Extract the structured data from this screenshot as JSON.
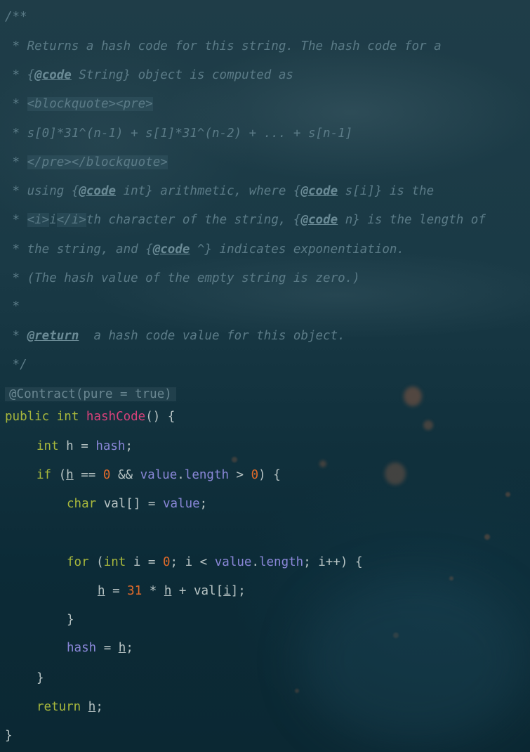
{
  "doc_comment": {
    "open": "/**",
    "line1": " * Returns a hash code for this string. The hash code for a",
    "line2_pre": " * {",
    "line2_tag": "@code",
    "line2_post": " String} object is computed as",
    "line3_star": " * ",
    "line3_html": "<blockquote><pre>",
    "line4": " * s[0]*31^(n-1) + s[1]*31^(n-2) + ... + s[n-1]",
    "line5_star": " * ",
    "line5_html": "</pre></blockquote>",
    "line6_a": " * using {",
    "line6_tag1": "@code",
    "line6_b": " int} arithmetic, where {",
    "line6_tag2": "@code",
    "line6_c": " s[i]} is the",
    "line7_star": " * ",
    "line7_html1": "<i>",
    "line7_i": "i",
    "line7_html2": "</i>",
    "line7_a": "th character of the string, {",
    "line7_tag": "@code",
    "line7_b": " n} is the length of",
    "line8_a": " * the string, and {",
    "line8_tag": "@code",
    "line8_b": " ^} indicates exponentiation.",
    "line9": " * (The hash value of the empty string is zero.)",
    "line10": " *",
    "line11_star": " * ",
    "line11_tag": "@return",
    "line11_b": "  a hash code value for this object.",
    "close": " */"
  },
  "annotation": "@Contract(pure = true)",
  "code": {
    "public": "public",
    "int": "int",
    "method_name": "hashCode",
    "signature_rest": "() {",
    "h": "h",
    "eq": " = ",
    "hash": "hash",
    "semi": ";",
    "if": "if",
    "open_paren": " (",
    "eqeq": " == ",
    "zero": "0",
    "and": " && ",
    "value": "value",
    "dot": ".",
    "length": "length",
    "gt": " > ",
    "close_brace_open": ") {",
    "char": "char",
    "val_decl": " val[] = ",
    "for": "for",
    "i_decl": " i = ",
    "semi_i_lt": "; i < ",
    "semi_ipp": "; i++) {",
    "thirty_one": "31",
    "times": " * ",
    "plus_val": " + val[",
    "i": "i",
    "bracket_semi": "];",
    "close_brace": "}",
    "return": "return"
  }
}
